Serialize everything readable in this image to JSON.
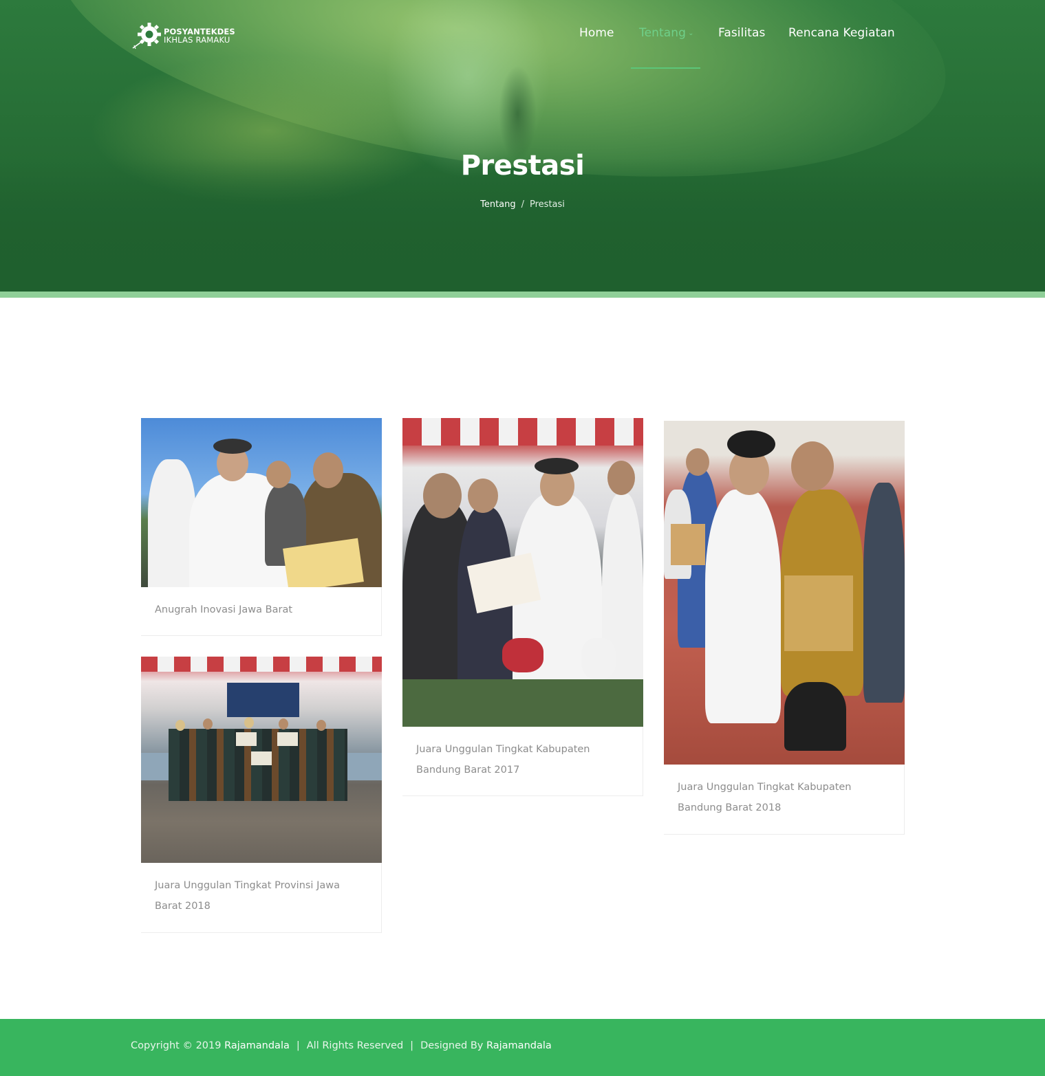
{
  "brand": {
    "line1": "POSYANTEKDES",
    "line2": "IKHLAS RAMAKU"
  },
  "nav": {
    "items": [
      {
        "label": "Home"
      },
      {
        "label": "Tentang"
      },
      {
        "label": "Fasilitas"
      },
      {
        "label": "Rencana Kegiatan"
      }
    ],
    "active": "Tentang"
  },
  "hero": {
    "title": "Prestasi",
    "breadcrumb": {
      "parent": "Tentang",
      "separator": "/",
      "current": "Prestasi"
    }
  },
  "gallery": [
    {
      "caption": "Anugrah Inovasi Jawa Barat"
    },
    {
      "caption": "Juara Unggulan Tingkat Kabupaten Bandung Barat 2017"
    },
    {
      "caption": "Juara Unggulan Tingkat Kabupaten Bandung Barat 2018"
    },
    {
      "caption": "Juara Unggulan Tingkat Provinsi Jawa Barat 2018"
    }
  ],
  "footer": {
    "copyright": "Copyright © 2019",
    "owner": "Rajamandala",
    "rights": "All Rights Reserved",
    "designed_by": "Designed By",
    "designer": "Rajamandala",
    "separator": "|"
  },
  "colors": {
    "hero_green": "#256b34",
    "accent": "#5cc679",
    "footer_green": "#38b55e"
  }
}
